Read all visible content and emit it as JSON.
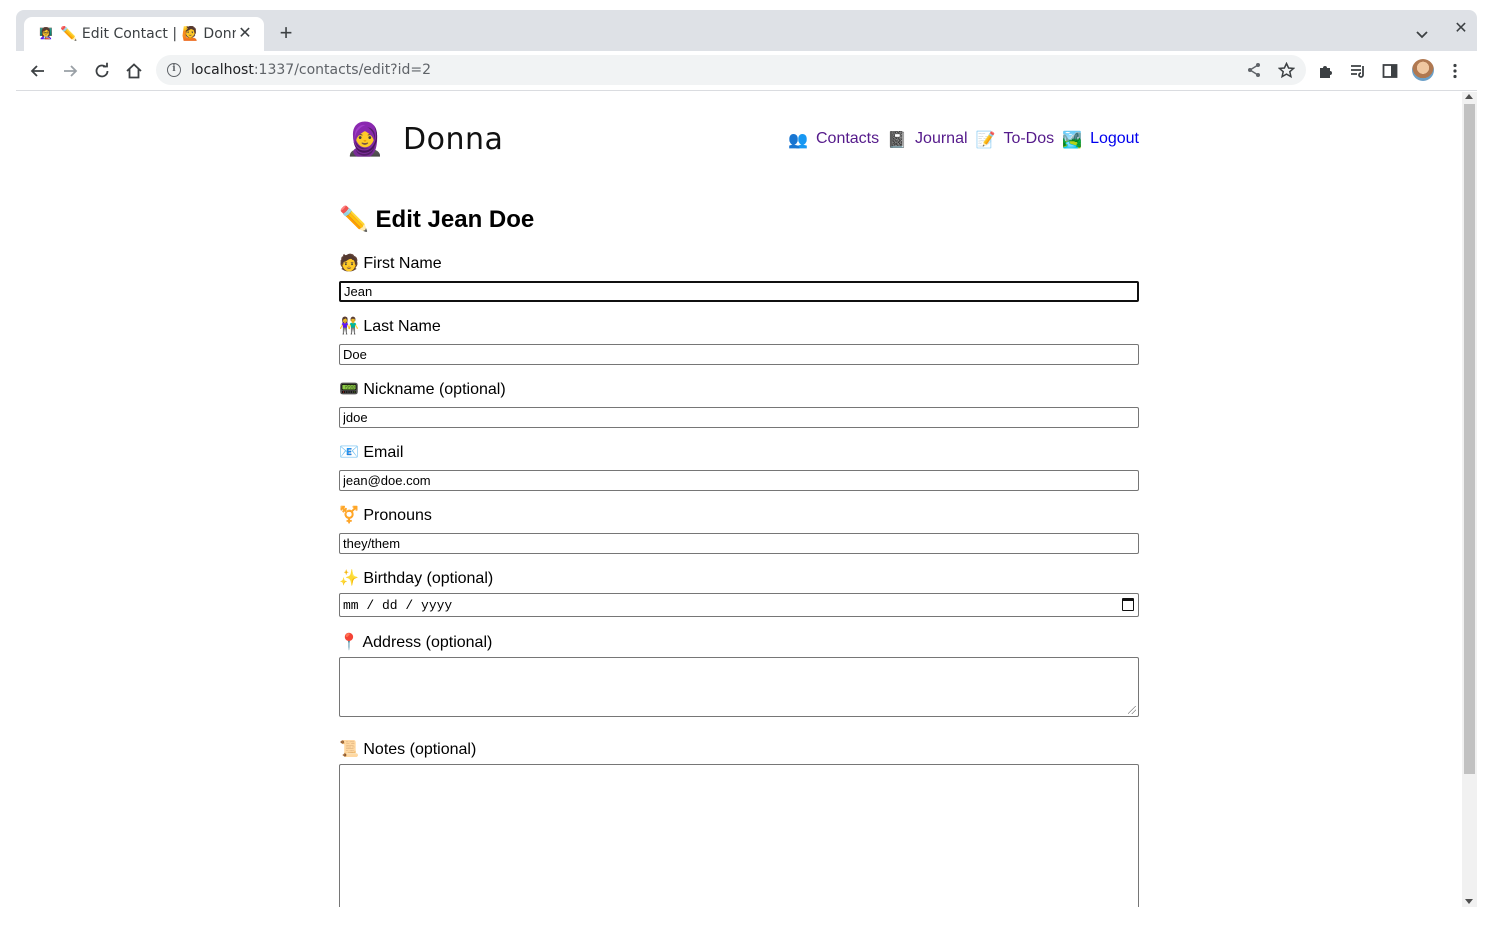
{
  "browser": {
    "tab": {
      "favicon": "👩‍🏫",
      "title": "✏️ Edit Contact | 🙋 Donna"
    },
    "url_host": "localhost",
    "url_path": ":1337/contacts/edit?id=2"
  },
  "app": {
    "logo": "🧕",
    "name": "Donna",
    "nav": [
      {
        "icon": "👥",
        "label": "Contacts"
      },
      {
        "icon": "📓",
        "label": "Journal"
      },
      {
        "icon": "📝",
        "label": "To-Dos"
      },
      {
        "icon": "🏞️",
        "label": "Logout"
      }
    ]
  },
  "form": {
    "title": "✏️ Edit Jean Doe",
    "first_name": {
      "label": "🧑 First Name",
      "value": "Jean"
    },
    "last_name": {
      "label": "👫 Last Name",
      "value": "Doe"
    },
    "nickname": {
      "label": "📟 Nickname (optional)",
      "value": "jdoe"
    },
    "email": {
      "label": "📧 Email",
      "value": "jean@doe.com"
    },
    "pronouns": {
      "label": "⚧️ Pronouns",
      "value": "they/them"
    },
    "birthday": {
      "label": "✨ Birthday (optional)",
      "placeholder": "mm / dd / yyyy"
    },
    "address": {
      "label": "📍 Address (optional)",
      "value": ""
    },
    "notes": {
      "label": "📜 Notes (optional)",
      "value": ""
    }
  }
}
